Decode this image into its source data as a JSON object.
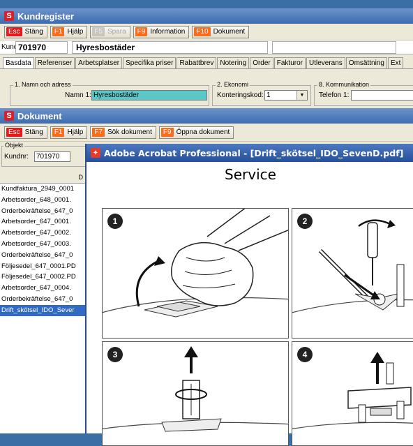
{
  "kundregister": {
    "title": "Kundregister",
    "app_icon_letter": "S",
    "toolbar": [
      {
        "key": "Esc",
        "label": "Stäng",
        "disabled": false
      },
      {
        "key": "F1",
        "label": "Hjälp",
        "disabled": false
      },
      {
        "key": "F5",
        "label": "Spara",
        "disabled": true
      },
      {
        "key": "F9",
        "label": "Information",
        "disabled": false
      },
      {
        "key": "F10",
        "label": "Dokument",
        "disabled": false
      }
    ],
    "kund_label": "Kund",
    "kund_number": "701970",
    "kund_name": "Hyresbostäder",
    "tabs": [
      "Basdata",
      "Referenser",
      "Arbetsplatser",
      "Specifika priser",
      "Rabattbrev",
      "Notering",
      "Order",
      "Fakturor",
      "Utleverans",
      "Omsättning",
      "Ext"
    ],
    "active_tab": "Basdata",
    "group_namn": "1. Namn och adress",
    "namn1_label": "Namn 1:",
    "namn1_value": "Hyresbostäder",
    "group_ekonomi": "2. Ekonomi",
    "konteringskod_label": "Konteringskod:",
    "konteringskod_value": "1",
    "group_kommunikation": "8. Kommunikation",
    "telefon_label": "Telefon 1:",
    "telefon_value": ""
  },
  "dokument": {
    "title": "Dokument",
    "app_icon_letter": "S",
    "toolbar": [
      {
        "key": "Esc",
        "label": "Stäng"
      },
      {
        "key": "F1",
        "label": "Hjälp"
      },
      {
        "key": "F7",
        "label": "Sök dokument"
      },
      {
        "key": "F9",
        "label": "Öppna dokument"
      }
    ],
    "objekt_label": "Objekt",
    "kundnr_label": "Kundnr:",
    "kundnr_value": "701970",
    "list_header": "D",
    "files": [
      "Kundfaktura_2949_0001",
      "Arbetsorder_648_0001.",
      "Orderbekräftelse_647_0",
      "Arbetsorder_647_0001.",
      "Arbetsorder_647_0002.",
      "Arbetsorder_647_0003.",
      "Orderbekräftelse_647_0",
      "Följesedel_647_0001.PD",
      "Följesedel_647_0002.PD",
      "Arbetsorder_647_0004.",
      "Orderbekräftelse_647_0",
      "Drift_skötsel_IDO_Sever"
    ],
    "selected_index": 11
  },
  "acrobat": {
    "title": "Adobe Acrobat Professional - [Drift_skötsel_IDO_SevenD.pdf]",
    "heading": "Service",
    "steps": [
      "1",
      "2",
      "3",
      "4"
    ]
  },
  "colors": {
    "titlebar": "#3c6cb0",
    "key_orange": "#fb6b1e",
    "selection": "#316ac5",
    "namn_field": "#5cc7c7"
  }
}
